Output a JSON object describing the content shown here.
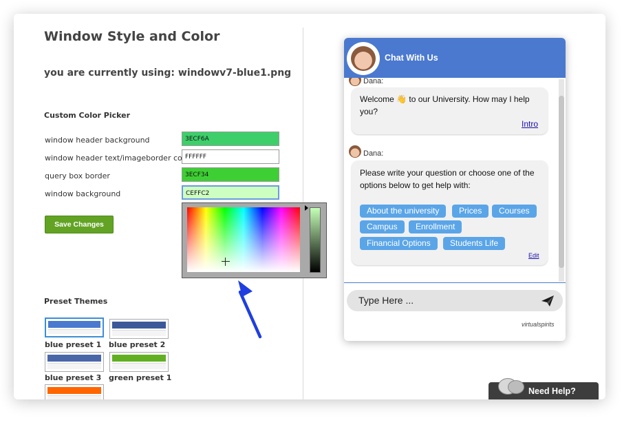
{
  "settings": {
    "title": "Window Style and Color",
    "current_text": "you are currently using: windowv7-blue1.png",
    "picker_heading": "Custom Color Picker",
    "fields": [
      {
        "label": "window header background",
        "value": "3ECF6A",
        "color": "#3ecf6a"
      },
      {
        "label": "window header text/imageborder color",
        "value": "FFFFFF",
        "color": "#ffffff"
      },
      {
        "label": "query box border",
        "value": "3ECF34",
        "color": "#3ecf34"
      },
      {
        "label": "window background",
        "value": "CEFFC2",
        "color": "#ceffc2"
      }
    ],
    "save_label": "Save Changes",
    "presets_heading": "Preset Themes",
    "presets": [
      {
        "name": "blue preset 1",
        "color": "#4a79cf"
      },
      {
        "name": "blue preset 2",
        "color": "#3b5998"
      },
      {
        "name": "blue preset 3",
        "color": "#4a66a8"
      },
      {
        "name": "green preset 1",
        "color": "#62b021"
      },
      {
        "name": "",
        "color": "#ff6600"
      }
    ]
  },
  "chat": {
    "title": "Chat With Us",
    "header_color": "#4a79cf",
    "messages": [
      {
        "sender": "Dana:",
        "text": "Welcome 👋 to our University. How may I help you?",
        "link": "Intro"
      },
      {
        "sender": "Dana:",
        "text": "Please write your question or choose one of the options below to get help with:",
        "edit": "Edit"
      }
    ],
    "options": [
      "About the university",
      "Prices",
      "Courses",
      "Campus",
      "Enrollment",
      "Financial Options",
      "Students Life"
    ],
    "input_placeholder": "Type Here ...",
    "brand": "virtualspirits"
  },
  "help_tab": {
    "label": "Need Help?"
  }
}
